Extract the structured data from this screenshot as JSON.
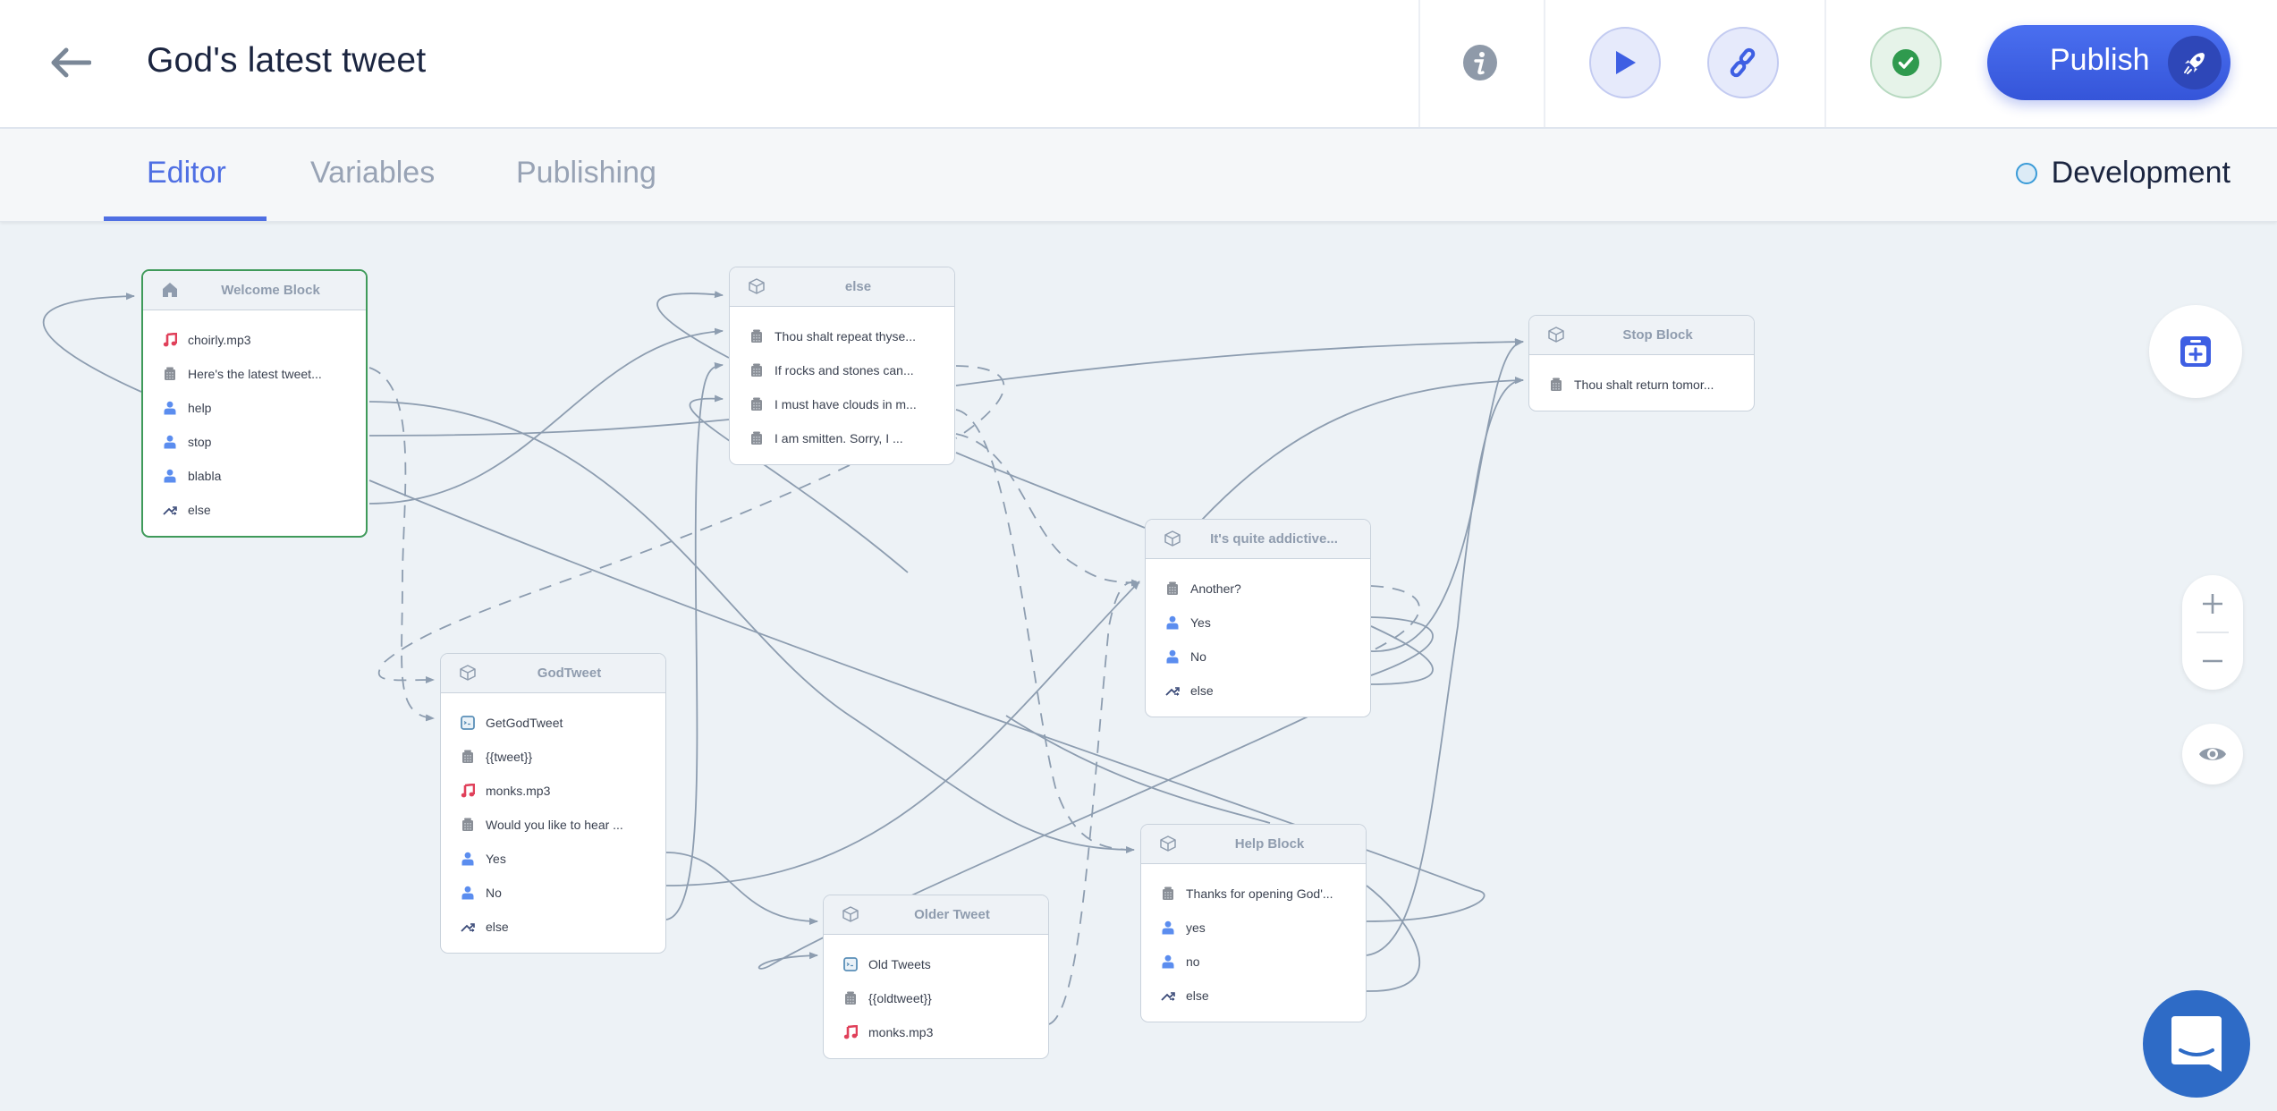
{
  "header": {
    "title": "God's latest tweet",
    "back_icon": "arrow-left-icon",
    "info_icon": "info-icon",
    "play_icon": "play-icon",
    "link_icon": "link-icon",
    "status_icon": "check-circle-icon",
    "publish_label": "Publish",
    "publish_icon": "rocket-icon"
  },
  "tabs": [
    {
      "label": "Editor",
      "active": true
    },
    {
      "label": "Variables",
      "active": false
    },
    {
      "label": "Publishing",
      "active": false
    }
  ],
  "environment": {
    "label": "Development"
  },
  "colors": {
    "accent": "#4f6fe3",
    "publish": "#3c5ee6",
    "start_block_border": "#3f9a5a",
    "edge": "#8d9db0",
    "audio_icon": "#e0405a",
    "user_icon": "#5b8def",
    "chat": "#2e6bc6"
  },
  "blocks": [
    {
      "id": "welcome",
      "title": "Welcome Block",
      "icon": "home-icon",
      "start": true,
      "items": [
        {
          "type": "audio",
          "label": "choirly.mp3"
        },
        {
          "type": "message",
          "label": "Here's the latest tweet..."
        },
        {
          "type": "user",
          "label": "help"
        },
        {
          "type": "user",
          "label": "stop"
        },
        {
          "type": "user",
          "label": "blabla"
        },
        {
          "type": "else",
          "label": "else"
        }
      ]
    },
    {
      "id": "else",
      "title": "else",
      "icon": "cube-icon",
      "items": [
        {
          "type": "message",
          "label": "Thou shalt repeat thyse..."
        },
        {
          "type": "message",
          "label": "If rocks and stones can..."
        },
        {
          "type": "message",
          "label": "I must have clouds in m..."
        },
        {
          "type": "message",
          "label": "I am smitten. Sorry, I ..."
        }
      ]
    },
    {
      "id": "stop",
      "title": "Stop Block",
      "icon": "cube-icon",
      "items": [
        {
          "type": "message",
          "label": "Thou shalt return tomor..."
        }
      ]
    },
    {
      "id": "addictive",
      "title": "It's quite addictive...",
      "icon": "cube-icon",
      "items": [
        {
          "type": "message",
          "label": "Another?"
        },
        {
          "type": "user",
          "label": "Yes"
        },
        {
          "type": "user",
          "label": "No"
        },
        {
          "type": "else",
          "label": "else"
        }
      ]
    },
    {
      "id": "godtweet",
      "title": "GodTweet",
      "icon": "cube-icon",
      "items": [
        {
          "type": "api",
          "label": "GetGodTweet"
        },
        {
          "type": "message",
          "label": "{{tweet}}"
        },
        {
          "type": "audio",
          "label": "monks.mp3"
        },
        {
          "type": "message",
          "label": "Would you like to hear ..."
        },
        {
          "type": "user",
          "label": "Yes"
        },
        {
          "type": "user",
          "label": "No"
        },
        {
          "type": "else",
          "label": "else"
        }
      ]
    },
    {
      "id": "older",
      "title": "Older Tweet",
      "icon": "cube-icon",
      "items": [
        {
          "type": "api",
          "label": "Old Tweets"
        },
        {
          "type": "message",
          "label": "{{oldtweet}}"
        },
        {
          "type": "audio",
          "label": "monks.mp3"
        }
      ]
    },
    {
      "id": "help",
      "title": "Help Block",
      "icon": "cube-icon",
      "items": [
        {
          "type": "message",
          "label": "Thanks for opening God'..."
        },
        {
          "type": "user",
          "label": "yes"
        },
        {
          "type": "user",
          "label": "no"
        },
        {
          "type": "else",
          "label": "else"
        }
      ]
    }
  ],
  "tools": {
    "add_block_icon": "add-block-icon",
    "zoom_in_icon": "plus-icon",
    "zoom_out_icon": "minus-icon",
    "preview_icon": "eye-icon",
    "chat_icon": "chat-bubble-icon"
  }
}
